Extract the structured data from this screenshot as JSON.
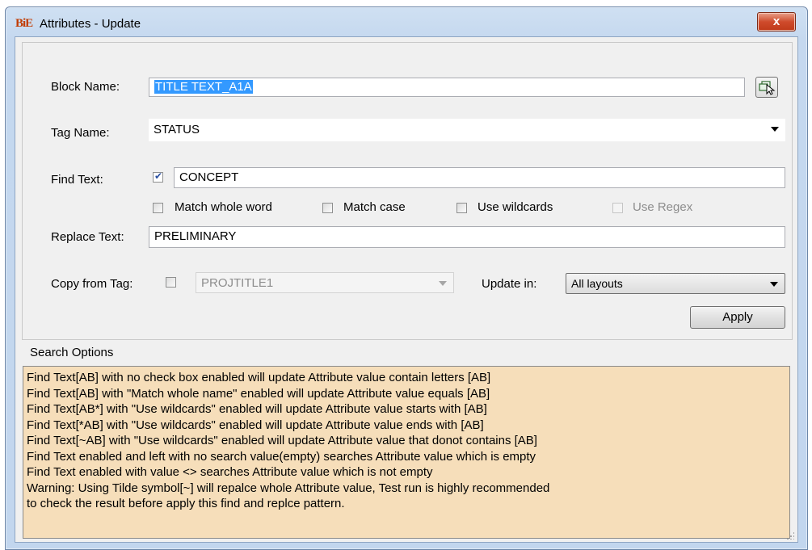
{
  "window": {
    "app_icon_text": "BiE",
    "title": "Attributes - Update",
    "close_label": "x"
  },
  "form": {
    "block_name_label": "Block Name:",
    "block_name_value": "TITLE TEXT_A1A",
    "tag_name_label": "Tag Name:",
    "tag_name_value": "STATUS",
    "find_text_label": "Find Text:",
    "find_text_checked": true,
    "find_text_value": "CONCEPT",
    "match_whole_word_label": "Match whole word",
    "match_case_label": "Match case",
    "use_wildcards_label": "Use wildcards",
    "use_regex_label": "Use Regex",
    "replace_text_label": "Replace Text:",
    "replace_text_value": "PRELIMINARY",
    "copy_from_tag_label": "Copy from Tag:",
    "copy_from_tag_value": "PROJTITLE1",
    "update_in_label": "Update in:",
    "update_in_value": "All layouts",
    "apply_label": "Apply"
  },
  "search_options": {
    "title": "Search Options",
    "lines": [
      "Find Text[AB] with no check box enabled will update Attribute value contain letters [AB]",
      "Find Text[AB] with \"Match whole name\" enabled will update Attribute value equals [AB]",
      "Find Text[AB*] with \"Use wildcards\" enabled will update Attribute value starts with [AB]",
      "Find Text[*AB] with \"Use wildcards\" enabled will update Attribute value ends with [AB]",
      "Find Text[~AB] with \"Use wildcards\" enabled will update Attribute value that donot contains [AB]",
      "Find Text enabled and  left with no search value(empty) searches Attribute value which is empty",
      "Find Text enabled with value <> searches Attribute value which is not empty",
      "Warning: Using Tilde symbol[~] will repalce whole Attribute value, Test run is highly recommended",
      "to check the result before apply this find and replce pattern."
    ]
  }
}
